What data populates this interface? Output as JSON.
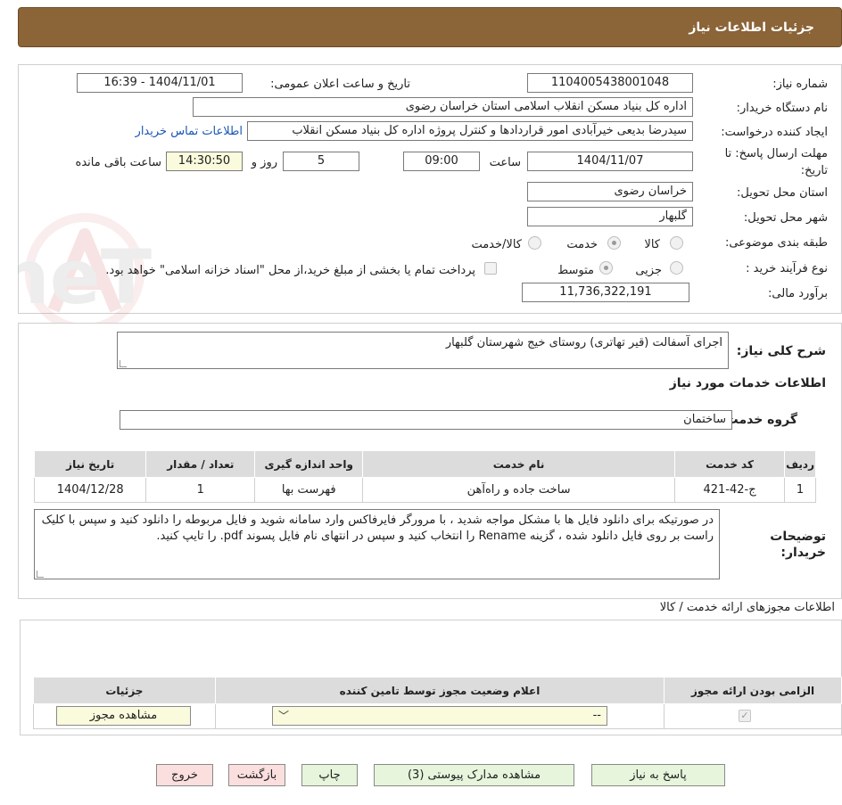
{
  "header": {
    "title": "جزئیات اطلاعات نیاز"
  },
  "watermark": {
    "text": "AriaTender.neT"
  },
  "form": {
    "need_number_label": "شماره نیاز:",
    "need_number": "1104005438001048",
    "announce_label": "تاریخ و ساعت اعلان عمومی:",
    "announce_value": "1404/11/01 - 16:39",
    "buyer_org_label": "نام دستگاه خریدار:",
    "buyer_org": "اداره کل بنیاد مسکن انقلاب اسلامی استان خراسان رضوی",
    "requester_label": "ایجاد کننده درخواست:",
    "requester": "سیدرضا بدیعی خیرآبادی امور قراردادها و کنترل پروژه اداره کل بنیاد مسکن انقلاب",
    "contact_link": "اطلاعات تماس خریدار",
    "deadline_label_1": "مهلت ارسال پاسخ: تا",
    "deadline_label_2": "تاریخ:",
    "deadline_date": "1404/11/07",
    "time_label": "ساعت",
    "deadline_time": "09:00",
    "days": "5",
    "days_label": "روز و",
    "remaining_time": "14:30:50",
    "remaining_label": "ساعت باقی مانده",
    "province_label": "استان محل تحویل:",
    "province": "خراسان رضوی",
    "city_label": "شهر محل تحویل:",
    "city": "گلبهار",
    "category_label": "طبقه بندی موضوعی:",
    "category_options": [
      "کالا",
      "خدمت",
      "کالا/خدمت"
    ],
    "category_selected": "خدمت",
    "process_label": "نوع فرآیند خرید :",
    "process_options": [
      "جزیی",
      "متوسط"
    ],
    "process_selected": "متوسط",
    "payment_note": "پرداخت تمام یا بخشی از مبلغ خرید،از محل \"اسناد خزانه اسلامی\" خواهد بود.",
    "budget_label": "برآورد مالی:",
    "budget": "11,736,322,191"
  },
  "description": {
    "label": "شرح کلی نیاز:",
    "value": "اجرای آسفالت (قیر تهاتری) روستای خیج شهرستان گلبهار"
  },
  "services": {
    "title": "اطلاعات خدمات مورد نیاز",
    "group_label": "گروه خدمت:",
    "group_value": "ساختمان",
    "columns": [
      "ردیف",
      "کد خدمت",
      "نام خدمت",
      "واحد اندازه گیری",
      "تعداد / مقدار",
      "تاریخ نیاز"
    ],
    "rows": [
      [
        "1",
        "ج-42-421",
        "ساخت جاده و راه‌آهن",
        "فهرست بها",
        "1",
        "1404/12/28"
      ]
    ]
  },
  "buyer_notes": {
    "label_1": "توضیحات",
    "label_2": "خریدار:",
    "value": "در صورتیکه برای دانلود فایل ها با مشکل مواجه شدید ، با مرورگر فایرفاکس وارد سامانه شوید و فایل مربوطه را دانلود کنید و سپس با کلیک راست بر روی فایل دانلود شده ، گزینه Rename را انتخاب کنید و سپس در انتهای نام فایل پسوند pdf. را تایپ کنید."
  },
  "permits": {
    "title": "اطلاعات مجوزهای ارائه خدمت / کالا",
    "columns": [
      "الزامی بودن ارائه مجوز",
      "اعلام وضعیت مجوز توسط تامین کننده",
      "جزئیات"
    ],
    "select_value": "--",
    "view_button": "مشاهده مجوز"
  },
  "actions": {
    "reply": "پاسخ به نیاز",
    "attachments": "مشاهده مدارک پیوستی (3)",
    "print": "چاپ",
    "back": "بازگشت",
    "exit": "خروج"
  }
}
